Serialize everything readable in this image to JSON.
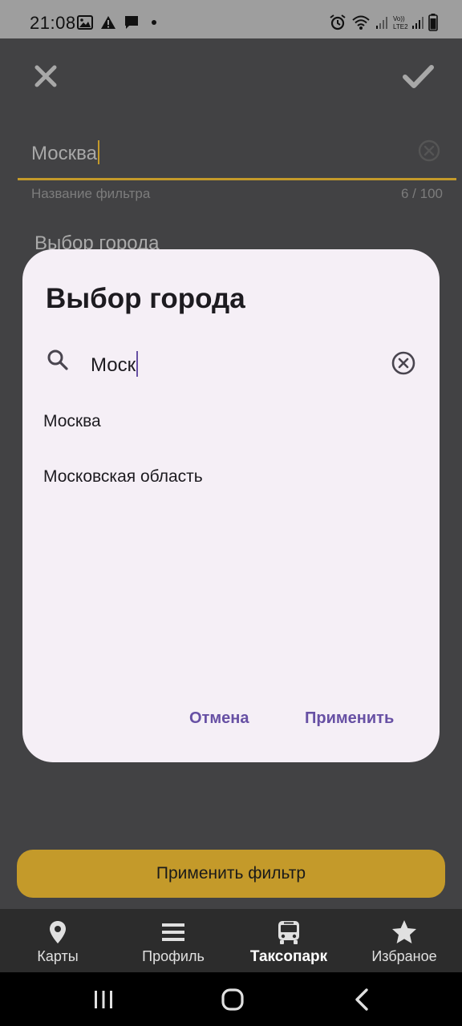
{
  "status_bar": {
    "time": "21:08",
    "left_icons": [
      "image-icon",
      "warning-icon",
      "message-icon",
      "dot-icon"
    ],
    "right_icons": [
      "alarm-icon",
      "wifi-icon",
      "signal-icon",
      "lte-signal-icon",
      "battery-icon"
    ],
    "lte_label": "Vo)) LTE2"
  },
  "toolbar": {
    "close_icon": "close-icon",
    "confirm_icon": "check-icon"
  },
  "filter_name": {
    "value": "Москва",
    "hint": "Название фильтра",
    "counter": "6 / 100"
  },
  "city_section": {
    "title": "Выбор города"
  },
  "dialog": {
    "title": "Выбор города",
    "search_value": "Моск",
    "results": [
      "Москва",
      "Московская область"
    ],
    "cancel_label": "Отмена",
    "apply_label": "Применить"
  },
  "apply_filter_label": "Применить фильтр",
  "bottom_nav": {
    "items": [
      {
        "label": "Карты",
        "icon": "map-pin-icon",
        "active": false
      },
      {
        "label": "Профиль",
        "icon": "menu-icon",
        "active": false
      },
      {
        "label": "Таксопарк",
        "icon": "bus-icon",
        "active": true
      },
      {
        "label": "Избраное",
        "icon": "star-icon",
        "active": false
      }
    ]
  },
  "system_nav": [
    "recents-icon",
    "home-icon",
    "back-icon"
  ],
  "colors": {
    "accent": "#c49a2a",
    "dialog_bg": "#f5eff6",
    "dialog_button": "#6750a4",
    "overlay": "#424244"
  }
}
